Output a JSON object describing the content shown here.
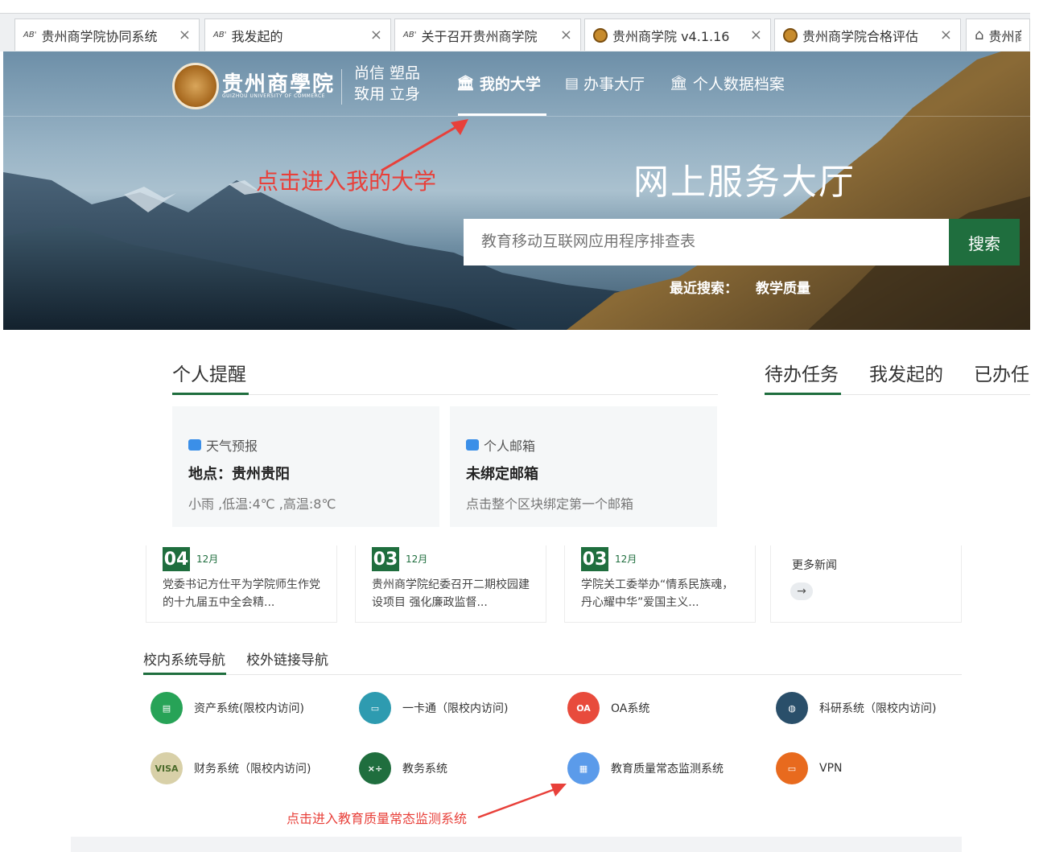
{
  "browser": {
    "tabs": [
      {
        "label": "贵州商学院协同系统",
        "favicon": "AB"
      },
      {
        "label": "我发起的",
        "favicon": "AB"
      },
      {
        "label": "关于召开贵州商学院",
        "favicon": "AB"
      },
      {
        "label": "贵州商学院 v4.1.16",
        "favicon": "seal"
      },
      {
        "label": "贵州商学院合格评估",
        "favicon": "seal"
      },
      {
        "label": "贵州商",
        "favicon": "home"
      }
    ]
  },
  "header": {
    "school_name": "贵州商學院",
    "school_name_en": "GUIZHOU UNIVERSITY OF COMMERCE",
    "motto_line1": "尚信 塑品",
    "motto_line2": "致用 立身",
    "nav": [
      {
        "label": "我的大学",
        "icon": "building-icon",
        "active": true
      },
      {
        "label": "办事大厅",
        "icon": "document-icon",
        "active": false
      },
      {
        "label": "个人数据档案",
        "icon": "building-icon",
        "active": false
      }
    ],
    "annotation": "点击进入我的大学"
  },
  "hero": {
    "title": "网上服务大厅",
    "search_placeholder": "教育移动互联网应用程序排查表",
    "search_button": "搜索",
    "recent_label": "最近搜索：",
    "recent_keyword": "教学质量"
  },
  "reminders": {
    "title": "个人提醒",
    "weather": {
      "heading": "天气预报",
      "location": "地点：贵州贵阳",
      "detail": "小雨 ,低温:4℃ ,高温:8℃"
    },
    "mail": {
      "heading": "个人邮箱",
      "status": "未绑定邮箱",
      "hint": "点击整个区块绑定第一个邮箱"
    }
  },
  "tasks": {
    "tabs": [
      "待办任务",
      "我发起的",
      "已办任"
    ]
  },
  "news": {
    "items": [
      {
        "day": "04",
        "month": "12月",
        "text": "党委书记方仕平为学院师生作党的十九届五中全会精..."
      },
      {
        "day": "03",
        "month": "12月",
        "text": "贵州商学院纪委召开二期校园建设项目 强化廉政监督..."
      },
      {
        "day": "03",
        "month": "12月",
        "text": "学院关工委举办“情系民族魂，丹心耀中华”爱国主义..."
      }
    ],
    "more": "更多新闻",
    "more_arrow": "→"
  },
  "systems": {
    "tabs": [
      "校内系统导航",
      "校外链接导航"
    ],
    "items": [
      {
        "label": "资产系统(限校内访问)",
        "icon": "server-icon",
        "color": "#27a357"
      },
      {
        "label": "一卡通（限校内访问)",
        "icon": "card-icon",
        "color": "#2e9bb0"
      },
      {
        "label": "OA系统",
        "icon": "oa-icon",
        "color": "#e84b3c"
      },
      {
        "label": "科研系统（限校内访问)",
        "icon": "globe-icon",
        "color": "#2a4f6a"
      },
      {
        "label": "财务系统（限校内访问)",
        "icon": "visa-card-icon",
        "color": "#d8d0a8"
      },
      {
        "label": "教务系统",
        "icon": "chalkboard-icon",
        "color": "#1f6e3e"
      },
      {
        "label": "教育质量常态监测系统",
        "icon": "clipboard-icon",
        "color": "#5b9bea"
      },
      {
        "label": "VPN",
        "icon": "monitor-icon",
        "color": "#e86a1e"
      }
    ],
    "annotation": "点击进入教育质量常态监测系统"
  },
  "colors": {
    "brand_green": "#1f6e3e",
    "annotation_red": "#e8403a"
  }
}
